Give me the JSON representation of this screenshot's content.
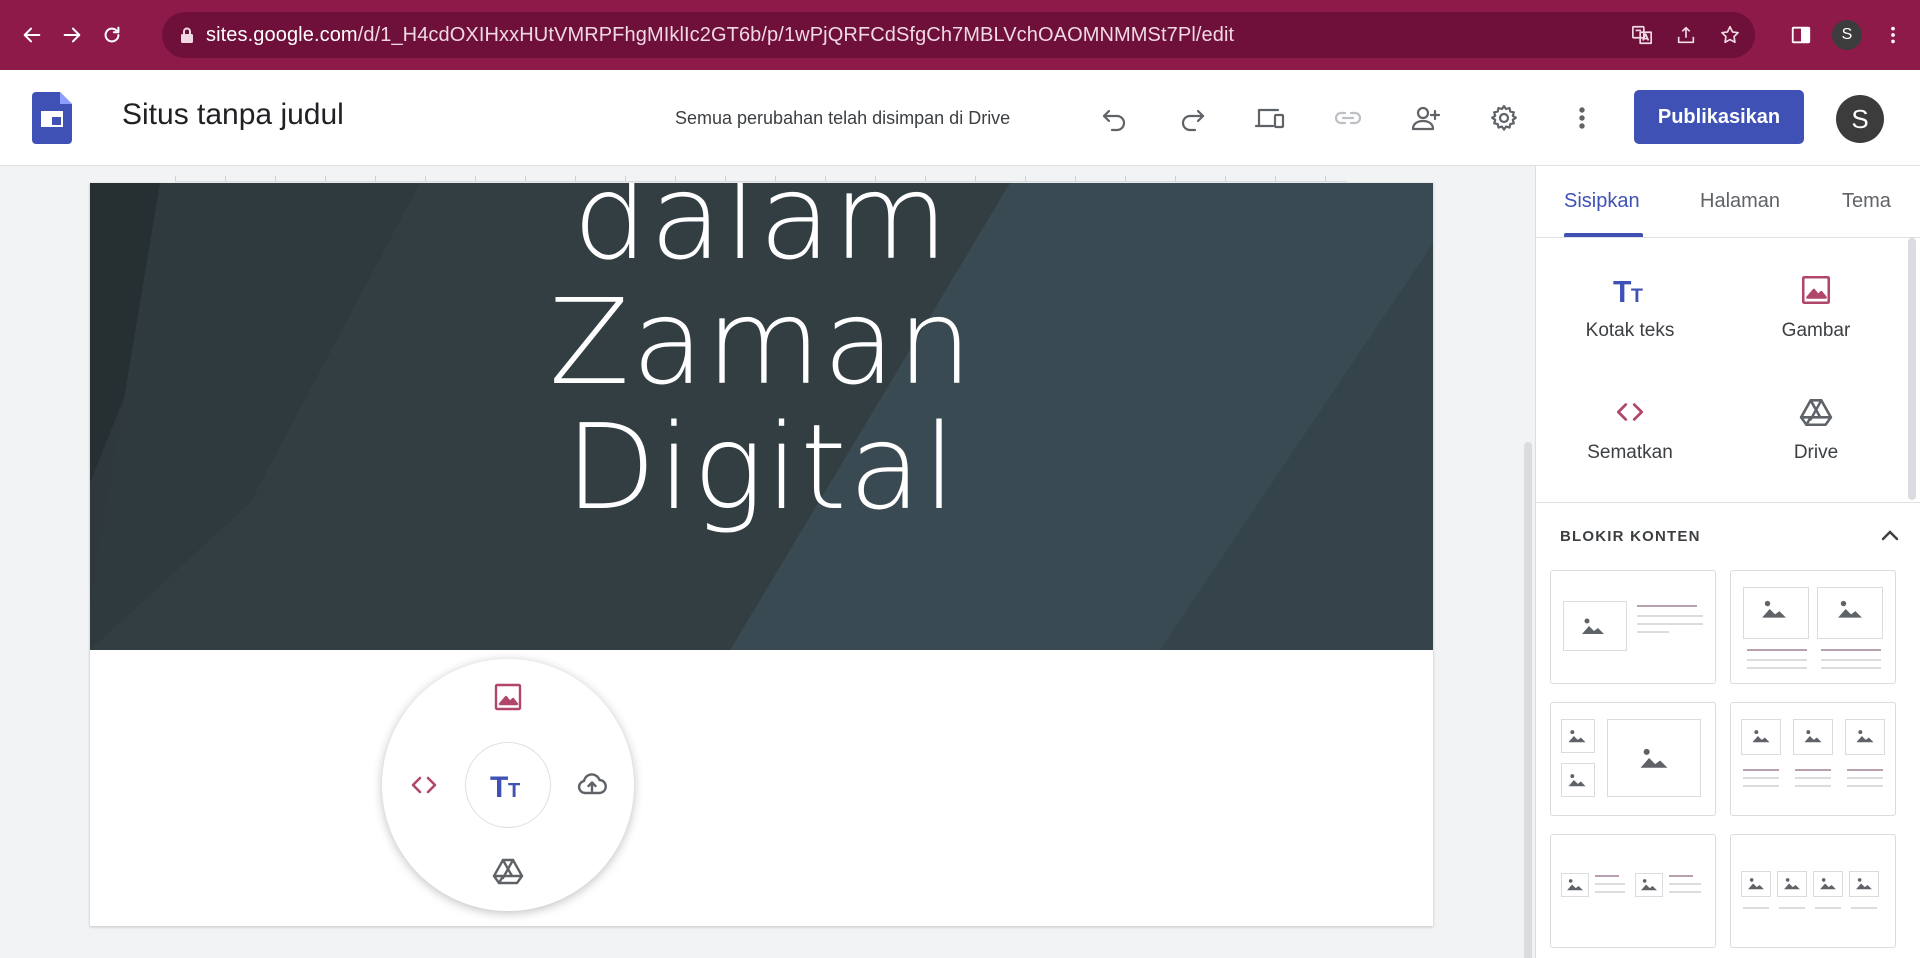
{
  "browser": {
    "url_host": "sites.google.com",
    "url_path": "/d/1_H4cdOXIHxxHUtVMRPFhgMIklIc2GT6b/p/1wPjQRFCdSfgCh7MBLVchOAOMNMMSt7Pl/edit",
    "profile_initial": "S",
    "theme_color": "#8e1a4a"
  },
  "app": {
    "site_title": "Situs tanpa judul",
    "save_status": "Semua perubahan telah disimpan di Drive",
    "publish_label": "Publikasikan",
    "avatar_initial": "S",
    "accent": "#3f51b5"
  },
  "hero": {
    "lines": [
      "dalam",
      "Zaman",
      "Digital"
    ]
  },
  "panel": {
    "tabs": [
      {
        "label": "Sisipkan",
        "active": true
      },
      {
        "label": "Halaman",
        "active": false
      },
      {
        "label": "Tema",
        "active": false
      }
    ],
    "insert_items": [
      {
        "label": "Kotak teks",
        "icon": "text-box-icon"
      },
      {
        "label": "Gambar",
        "icon": "image-icon"
      },
      {
        "label": "Sematkan",
        "icon": "embed-icon"
      },
      {
        "label": "Drive",
        "icon": "drive-icon"
      }
    ],
    "section_title": "BLOKIR KONTEN"
  },
  "radial_menu": {
    "icons": [
      "image-icon",
      "embed-icon",
      "text-icon",
      "upload-icon",
      "drive-icon"
    ]
  }
}
